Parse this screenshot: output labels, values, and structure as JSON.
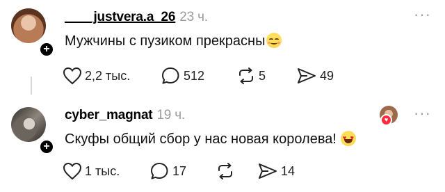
{
  "posts": [
    {
      "username": "____justvera.a_26",
      "time": "23 ч.",
      "text": "Мужчины с пузиком прекрасны",
      "emoji": "smiling-face-icon",
      "likes": "2,2 тыс.",
      "comments": "512",
      "reposts": "5",
      "shares": "49"
    },
    {
      "username": "cyber_magnat",
      "time": "19 ч.",
      "text": "Скуфы общий сбор у нас новая королева!",
      "emoji": "heart-eyes-icon",
      "likes": "1 тыс.",
      "comments": "17",
      "reposts": "",
      "shares": "14"
    }
  ],
  "more_label": "···",
  "follow_label": "+",
  "liked_by_author_icon": "heart-icon"
}
